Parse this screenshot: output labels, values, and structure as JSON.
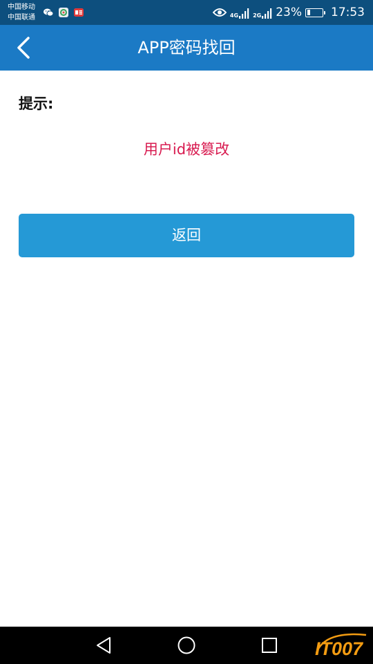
{
  "status_bar": {
    "carrier_1": "中国移动",
    "carrier_2": "中国联通",
    "notification_icons": [
      "wechat-icon",
      "app-icon",
      "toutiao-icon"
    ],
    "network_1": "4G",
    "network_2": "2G",
    "battery_percent": "23%",
    "battery_level": 0.23,
    "time": "17:53"
  },
  "app_bar": {
    "title": "APP密码找回",
    "back_icon": "chevron-left-icon"
  },
  "content": {
    "hint_label": "提示:",
    "message": "用户id被篡改",
    "return_button": "返回"
  },
  "nav_bar": {
    "back_icon": "triangle-back-icon",
    "home_icon": "circle-home-icon",
    "recent_icon": "square-recent-icon"
  },
  "watermark": {
    "text": "IT007"
  },
  "colors": {
    "status_bar_bg": "#0d4f7e",
    "app_bar_bg": "#1b7ac5",
    "button_bg": "#2599d6",
    "message_text": "#d81b50",
    "nav_bar_bg": "#000000",
    "watermark_orange": "#f39c12"
  }
}
